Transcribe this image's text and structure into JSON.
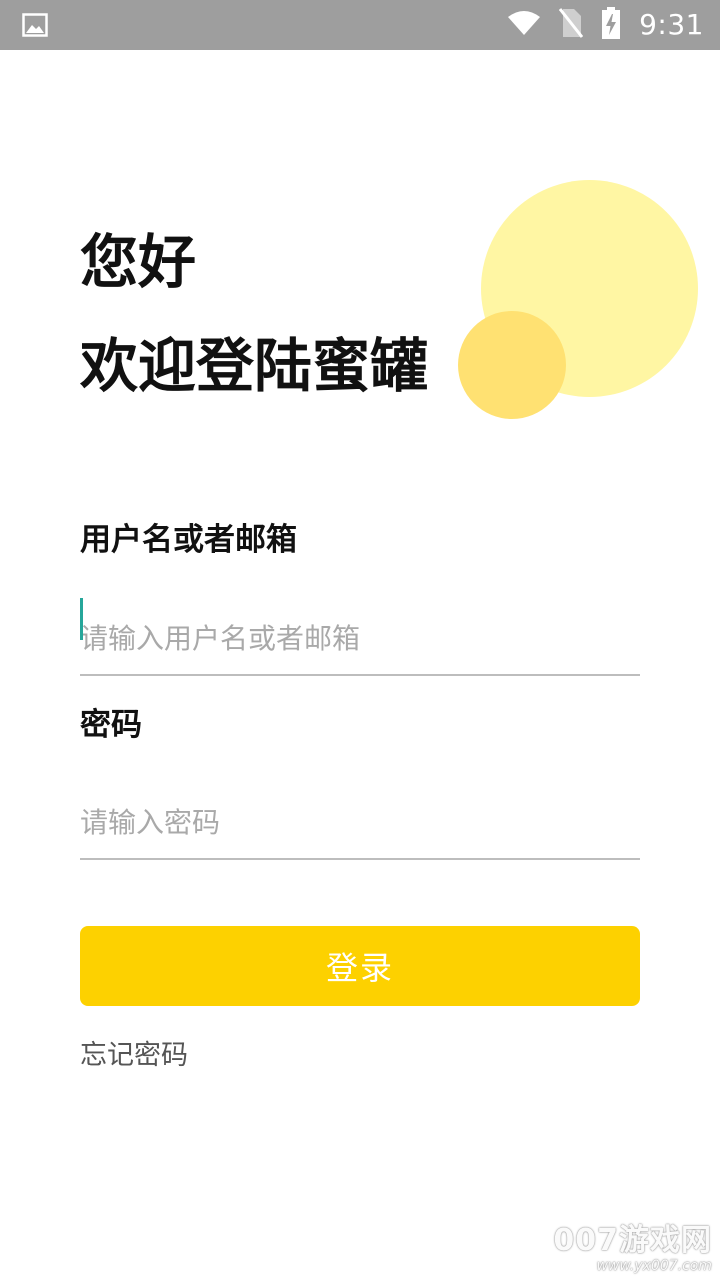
{
  "status_bar": {
    "time": "9:31",
    "icons": [
      "image-icon",
      "wifi-icon",
      "no-sim-icon",
      "battery-charging-icon"
    ],
    "background": "#9e9e9e"
  },
  "header": {
    "greeting": "您好",
    "welcome": "欢迎登陆蜜罐"
  },
  "decor": {
    "circle_large_color": "#fff6a3",
    "circle_small_color": "#ffe172"
  },
  "form": {
    "username_label": "用户名或者邮箱",
    "username_placeholder": "请输入用户名或者邮箱",
    "username_value": "",
    "password_label": "密码",
    "password_placeholder": "请输入密码",
    "password_value": "",
    "login_label": "登录",
    "login_color": "#fdd100",
    "forgot_label": "忘记密码"
  },
  "watermark": {
    "brand": "007游戏网",
    "url": "www.yx007.com"
  }
}
